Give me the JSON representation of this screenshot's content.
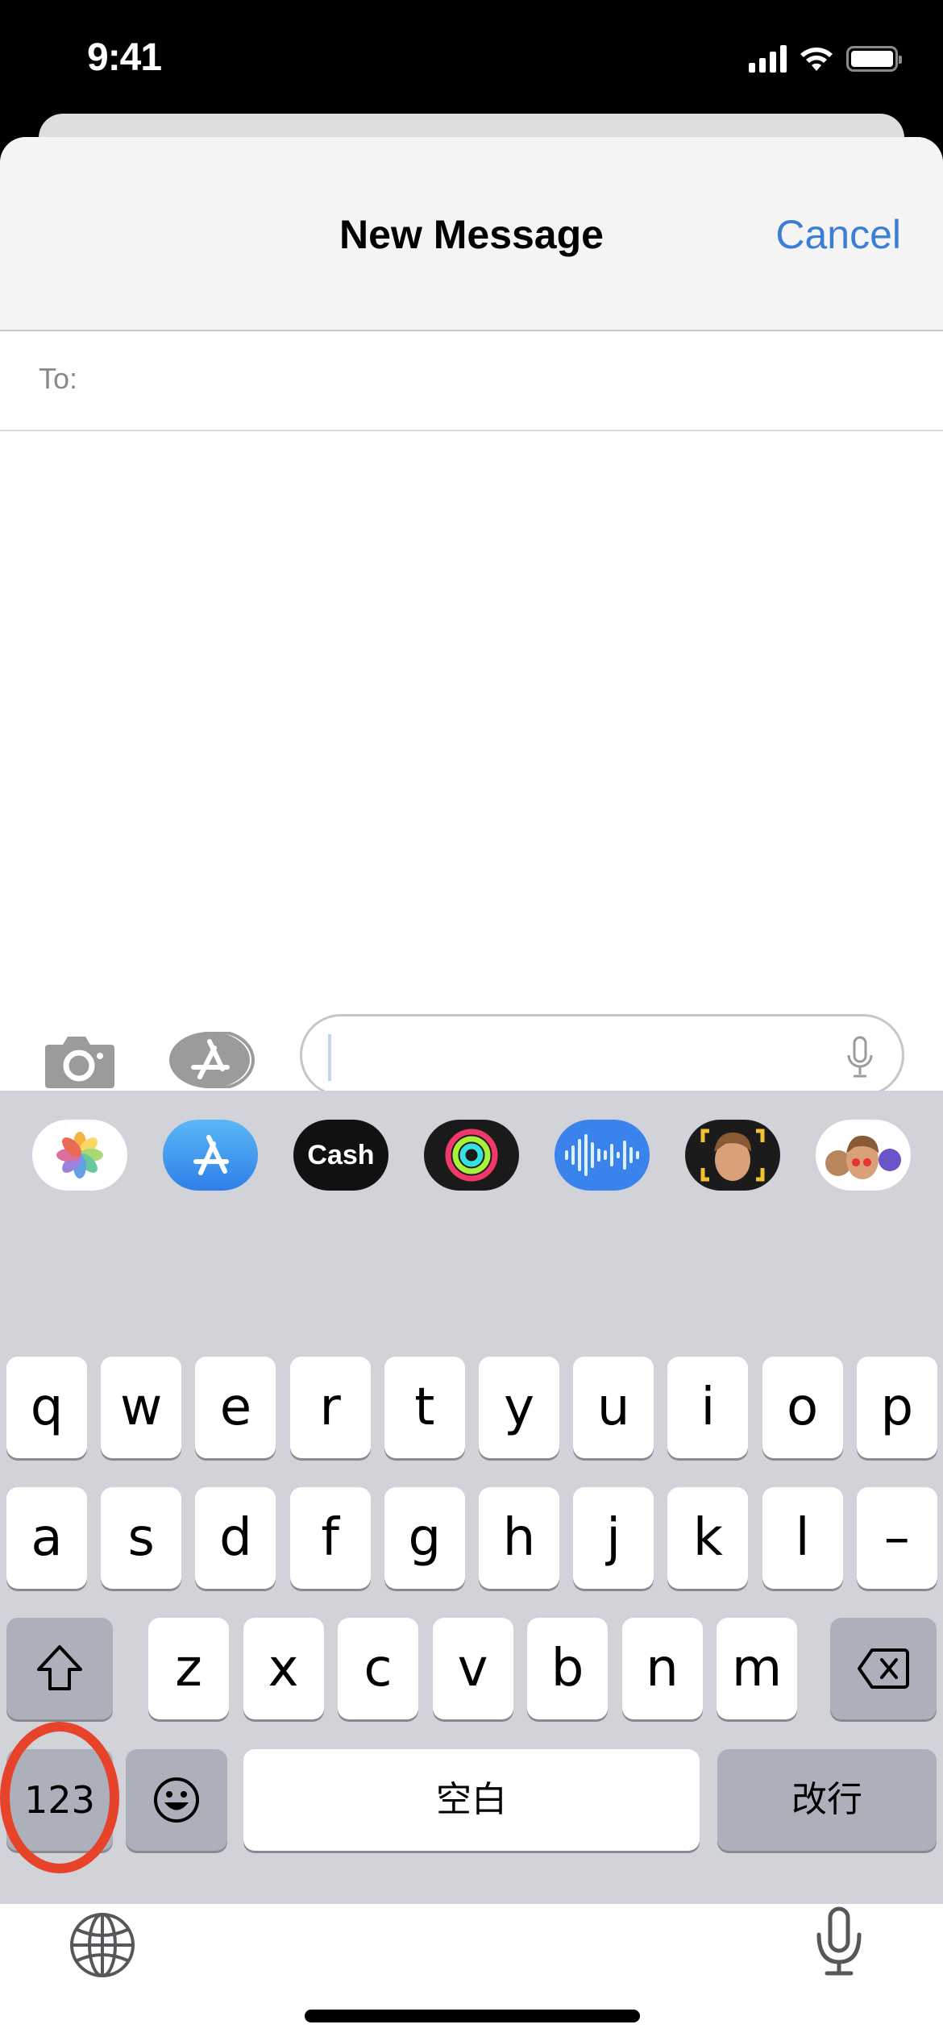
{
  "status_bar": {
    "time": "9:41",
    "icons": [
      "cellular-signal-icon",
      "wifi-icon",
      "battery-icon"
    ]
  },
  "header": {
    "title": "New Message",
    "cancel_label": "Cancel",
    "accent_color": "#3a7fd5"
  },
  "recipient": {
    "label": "To:",
    "value": "",
    "placeholder": ""
  },
  "compose": {
    "message_value": "",
    "placeholder": "",
    "camera_icon": "camera-icon",
    "apps_icon": "app-store-icon",
    "mic_icon": "microphone-icon"
  },
  "app_drawer": [
    {
      "name": "Photos",
      "icon": "photos-icon"
    },
    {
      "name": "App Store",
      "icon": "app-store-icon"
    },
    {
      "name": "Cash",
      "icon": "apple-cash-icon",
      "text": "Cash"
    },
    {
      "name": "Activity",
      "icon": "activity-rings-icon"
    },
    {
      "name": "Audio",
      "icon": "audio-waveform-icon"
    },
    {
      "name": "Memoji",
      "icon": "memoji-icon"
    },
    {
      "name": "Memoji Stickers",
      "icon": "memoji-stickers-icon"
    }
  ],
  "keyboard": {
    "row1": [
      "q",
      "w",
      "e",
      "r",
      "t",
      "y",
      "u",
      "i",
      "o",
      "p"
    ],
    "row2": [
      "a",
      "s",
      "d",
      "f",
      "g",
      "h",
      "j",
      "k",
      "l",
      "–"
    ],
    "row3": [
      "z",
      "x",
      "c",
      "v",
      "b",
      "n",
      "m"
    ],
    "shift_icon": "shift-icon",
    "delete_icon": "delete-backspace-icon",
    "numbers_label": "123",
    "emoji_icon": "emoji-icon",
    "space_label": "空白",
    "return_label": "改行",
    "globe_icon": "globe-icon",
    "dictation_icon": "microphone-icon",
    "highlight_color": "#e6432a",
    "highlighted_key": "123"
  }
}
